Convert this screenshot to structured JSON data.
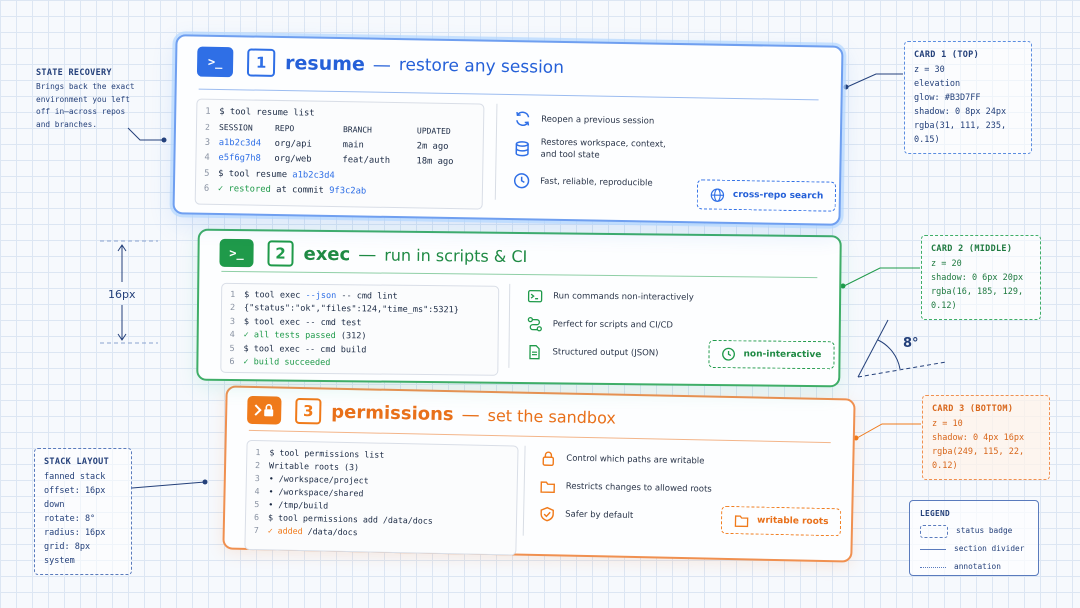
{
  "colors": {
    "blue": "#2f6fe6",
    "green": "#1f9a4a",
    "orange": "#f07a1a",
    "navy": "#24407a"
  },
  "state_recovery": {
    "heading": "STATE RECOVERY",
    "lines": [
      "Brings back the exact",
      "environment you left",
      "off in—across repos",
      "and branches."
    ]
  },
  "stack_layout": {
    "heading": "STACK LAYOUT",
    "lines": [
      "fanned stack",
      "offset: 16px down",
      "rotate: 8°",
      "radius: 16px",
      "grid: 8px system"
    ]
  },
  "offset_label": "16px",
  "angle_label": "8°",
  "card1_note": {
    "heading": "CARD 1 (TOP)",
    "lines": [
      "z = 30",
      "elevation",
      "glow: #B3D7FF",
      "shadow: 0 8px 24px",
      "rgba(31, 111, 235, 0.15)"
    ]
  },
  "card2_note": {
    "heading": "CARD 2 (MIDDLE)",
    "lines": [
      "z = 20",
      "shadow: 0 6px 20px",
      "rgba(16, 185, 129, 0.12)"
    ]
  },
  "card3_note": {
    "heading": "CARD 3 (BOTTOM)",
    "lines": [
      "z = 10",
      "shadow: 0 4px 16px",
      "rgba(249, 115, 22, 0.12)"
    ]
  },
  "legend": {
    "heading": "LEGEND",
    "items": [
      "status badge",
      "section divider",
      "annotation"
    ]
  },
  "card1": {
    "icon": ">_",
    "number": "1",
    "command": "resume",
    "dash": "—",
    "subtitle": "restore any session",
    "code": [
      {
        "n": "1",
        "t": "$ tool resume list"
      },
      {
        "n": "2",
        "cols": [
          "SESSION",
          "REPO",
          "BRANCH",
          "UPDATED"
        ]
      },
      {
        "n": "3",
        "cols": [
          "a1b2c3d4",
          "org/api",
          "main",
          "2m ago"
        ]
      },
      {
        "n": "4",
        "cols": [
          "e5f6g7h8",
          "org/web",
          "feat/auth",
          "18m ago"
        ]
      },
      {
        "n": "5",
        "pre": "$ tool resume ",
        "hl": "a1b2c3d4"
      },
      {
        "n": "6",
        "check": "✓ restored",
        "mid": " at commit ",
        "hl": "9f3c2ab"
      }
    ],
    "features": [
      "Reopen a previous session",
      "Restores workspace, context,",
      "and tool state",
      "Fast, reliable, reproducible"
    ],
    "badge": "cross-repo search"
  },
  "card2": {
    "icon": ">_",
    "number": "2",
    "command": "exec",
    "dash": "—",
    "subtitle": "run in scripts & CI",
    "code": [
      {
        "n": "1",
        "pre": "$ tool exec ",
        "hl": "--json",
        "post": " -- cmd lint"
      },
      {
        "n": "2",
        "t": "{\"status\":\"ok\",\"files\":124,\"time_ms\":5321}"
      },
      {
        "n": "3",
        "t": "$ tool exec -- cmd test"
      },
      {
        "n": "4",
        "check": "✓ all tests passed",
        "post": " (312)"
      },
      {
        "n": "5",
        "t": "$ tool exec -- cmd build"
      },
      {
        "n": "6",
        "check": "✓ build succeeded"
      }
    ],
    "features": [
      "Run commands non-interactively",
      "Perfect for scripts and CI/CD",
      "Structured output (JSON)"
    ],
    "badge": "non-interactive"
  },
  "card3": {
    "icon": ">🔒",
    "number": "3",
    "command": "permissions",
    "dash": "—",
    "subtitle": "set the sandbox",
    "code": [
      {
        "n": "1",
        "t": "$ tool permissions list"
      },
      {
        "n": "2",
        "t": "Writable roots (3)"
      },
      {
        "n": "3",
        "t": "• /workspace/project"
      },
      {
        "n": "4",
        "t": "• /workspace/shared"
      },
      {
        "n": "5",
        "t": "• /tmp/build"
      },
      {
        "n": "6",
        "t": "$ tool permissions add /data/docs"
      },
      {
        "n": "7",
        "check": "✓ added",
        "post": " /data/docs"
      }
    ],
    "features": [
      "Control which paths are writable",
      "Restricts changes to allowed roots",
      "Safer by default"
    ],
    "badge": "writable roots"
  }
}
